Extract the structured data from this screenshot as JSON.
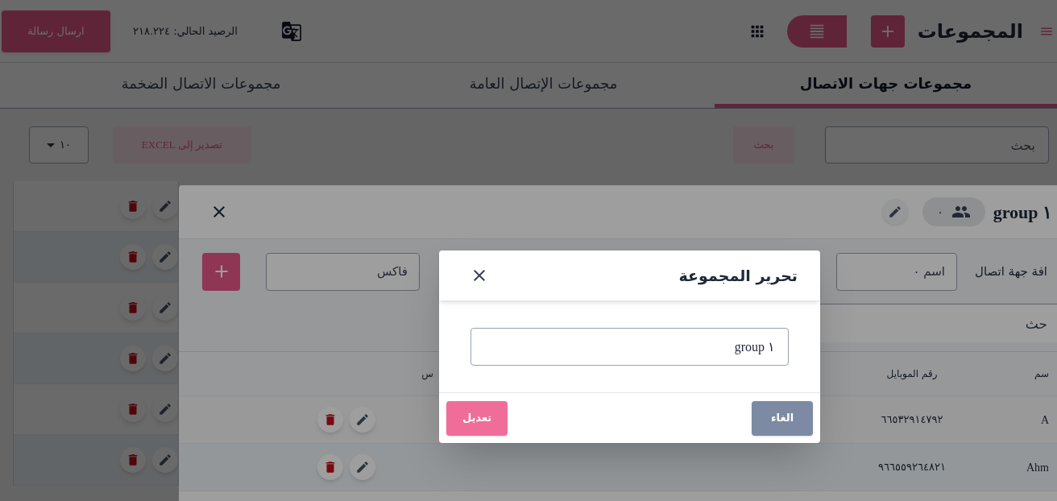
{
  "topbar": {
    "title": "المجموعات",
    "send_button": "ارسال رسالة",
    "balance": "الرصيد الحالي: ٢١٨.٢٢٤",
    "list_view_on": true
  },
  "tabs": [
    {
      "label": "مجموعات جهات الاتصال",
      "selected": true
    },
    {
      "label": "مجموعات الإتصال العامة",
      "selected": false
    },
    {
      "label": "مجموعات الاتصال الضخمة",
      "selected": false
    }
  ],
  "toolbar": {
    "search": {
      "placeholder": "بحث"
    },
    "search_button": "بحث",
    "export_button": "تصدير إلى EXCEL",
    "page_size": "١٠"
  },
  "list_rows": [
    {
      "kind": "actions"
    },
    {
      "kind": "actions"
    },
    {
      "kind": "actions"
    },
    {
      "kind": "actions"
    },
    {
      "kind": "actions"
    },
    {
      "kind": "actions"
    }
  ],
  "group_modal": {
    "title": "group ١",
    "member_count": "٠",
    "add_contact": {
      "label": "افة جهة اتصال",
      "name_placeholder": "اسم ٠",
      "fax_placeholder": "فاكس"
    },
    "search": {
      "placeholder": "حث"
    },
    "columns": [
      "سم",
      "رقم الموبايل",
      "س"
    ],
    "rows": [
      {
        "name": "A",
        "mobile": "٦٦٥٣٢٩١٤٧٩٢"
      },
      {
        "name": "Ahm",
        "mobile": "٩٦٦٥٥٩٢٦٤٨٢١"
      }
    ]
  },
  "edit_dialog": {
    "title": "تحرير المجموعة",
    "value": "group ١",
    "cancel_button": "الغاء",
    "submit_button": "تعديل"
  }
}
